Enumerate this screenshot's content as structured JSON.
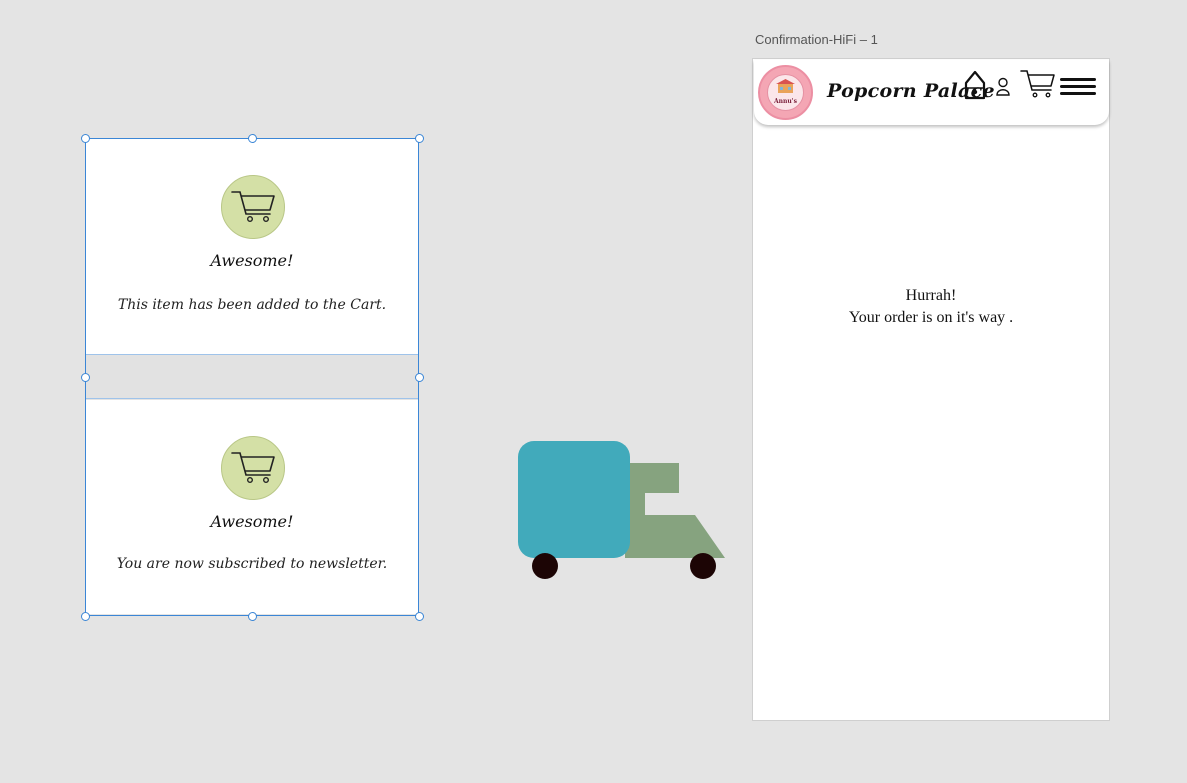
{
  "cards": [
    {
      "title": "Awesome!",
      "message": "This item has been added to the Cart.",
      "icon": "shopping-cart-icon"
    },
    {
      "title": "Awesome!",
      "message": "You are now subscribed to newsletter.",
      "icon": "shopping-cart-icon"
    }
  ],
  "artboard": {
    "label": "Confirmation-HiFi – 1",
    "brand": "Popcorn Palace",
    "logo_text": "Annu's",
    "header_icons": [
      "home-icon",
      "user-icon",
      "shopping-cart-icon",
      "hamburger-menu-icon"
    ],
    "confirmation": {
      "line1": "Hurrah!",
      "line2": "Your order is on it's way ."
    }
  },
  "colors": {
    "canvas": "#e4e4e4",
    "selection": "#3b86d6",
    "cart_circle": "#d4e0a6",
    "truck_cab": "#41aabb",
    "truck_body": "#86a37f",
    "truck_wheels": "#1c0505",
    "logo_pink": "#f4a6b4"
  }
}
